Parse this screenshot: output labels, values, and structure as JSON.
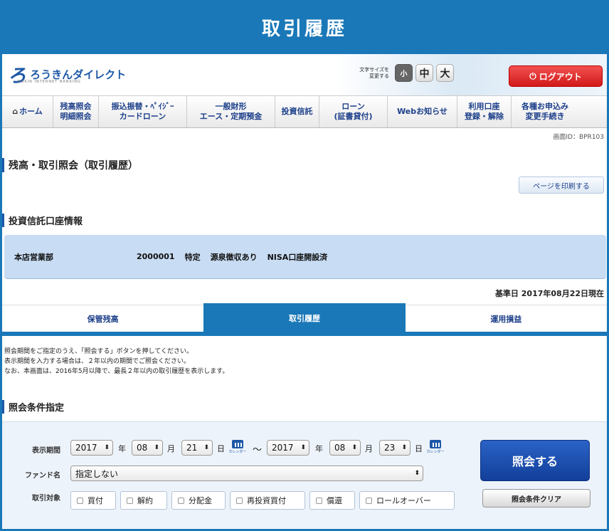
{
  "header": {
    "title": "取引履歴"
  },
  "brand": {
    "logo_mark": "ろ",
    "logo_text": "ろうきんダイレクト",
    "logo_sub": "ROKIN INTERNET BANKING"
  },
  "font_size": {
    "label_line1": "文字サイズを",
    "label_line2": "変更する",
    "small": "小",
    "medium": "中",
    "large": "大"
  },
  "logout": {
    "label": "ログアウト",
    "icon": "power-icon"
  },
  "nav": [
    {
      "line1": "ホーム",
      "line2": ""
    },
    {
      "line1": "残高照会",
      "line2": "明細照会"
    },
    {
      "line1": "振込振替・ﾍﾟｲｼﾞｰ",
      "line2": "カードローン"
    },
    {
      "line1": "一般財形",
      "line2": "エース・定期預金"
    },
    {
      "line1": "投資信託",
      "line2": ""
    },
    {
      "line1": "ローン",
      "line2": "(証書貸付)"
    },
    {
      "line1": "Webお知らせ",
      "line2": ""
    },
    {
      "line1": "利用口座",
      "line2": "登録・解除"
    },
    {
      "line1": "各種お申込み",
      "line2": "変更手続き"
    }
  ],
  "screen_id": "画面ID：BPR103",
  "page_title": "残高・取引照会（取引履歴）",
  "print_button": "ページを印刷する",
  "account_section_title": "投資信託口座情報",
  "account": {
    "branch": "本店営業部",
    "number": "2000001",
    "type": "特定",
    "tax": "源泉徴収あり",
    "nisa": "NISA口座開設済"
  },
  "base_date": "基準日 2017年08月22日現在",
  "tabs": [
    {
      "label": "保管残高",
      "active": false
    },
    {
      "label": "取引履歴",
      "active": true
    },
    {
      "label": "運用損益",
      "active": false
    }
  ],
  "notes": [
    "照会期間をご指定のうえ、「照会する」ボタンを押してください。",
    "表示期間を入力する場合は、２年以内の期間でご照会ください。",
    "なお、本画面は、2016年5月以降で、最長２年以内の取引履歴を表示します。"
  ],
  "condition_title": "照会条件指定",
  "form": {
    "period_label": "表示期間",
    "from": {
      "year": "2017",
      "month": "08",
      "day": "21"
    },
    "to": {
      "year": "2017",
      "month": "08",
      "day": "23"
    },
    "unit_year": "年",
    "unit_month": "月",
    "unit_day": "日",
    "tilde": "〜",
    "calendar_caption": "カレンダー",
    "fund_label": "ファンド名",
    "fund_value": "指定しない",
    "target_label": "取引対象",
    "targets": [
      "買付",
      "解約",
      "分配金",
      "再投資買付",
      "償還",
      "ロールオーバー"
    ],
    "search_button": "照会する",
    "clear_button": "照会条件クリア"
  },
  "colors": {
    "primary": "#1a78b8",
    "navy": "#1c3f8a",
    "logout": "#d21a1a",
    "account_bg": "#c8dcf3"
  }
}
